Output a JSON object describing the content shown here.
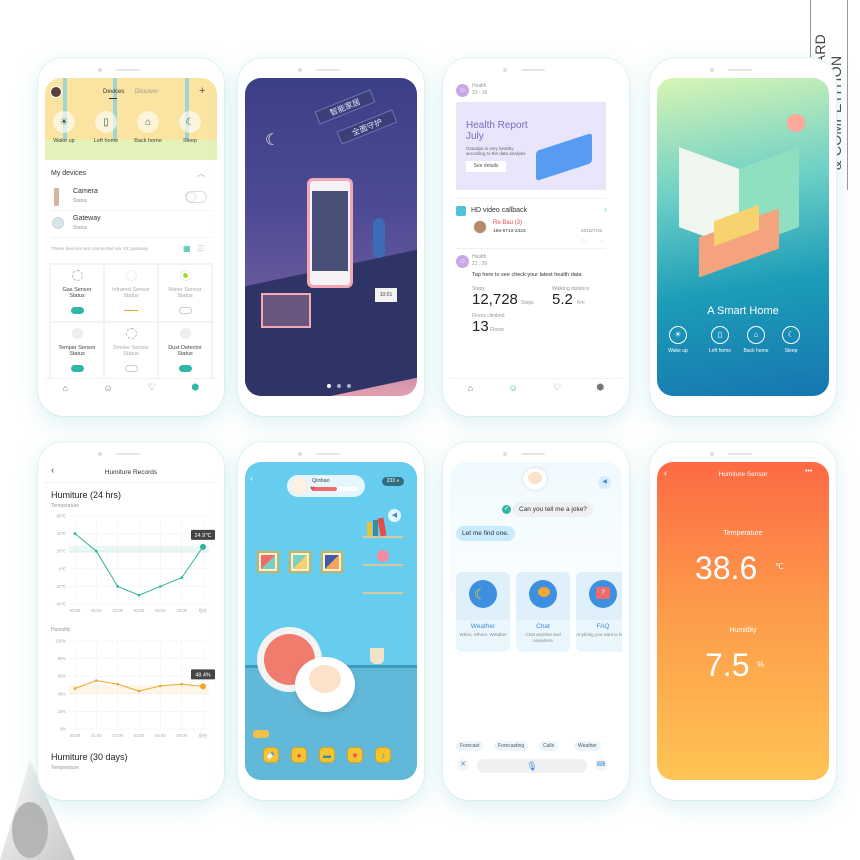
{
  "award": {
    "line1": "A'DESIGN AWARD",
    "line2": "& COMPETITION"
  },
  "phone1": {
    "tabs": [
      "Devices",
      "Discover"
    ],
    "add_icon": "+",
    "scenes": [
      {
        "label": "Wake up",
        "icon": "sunrise-icon"
      },
      {
        "label": "Left home",
        "icon": "door-icon"
      },
      {
        "label": "Back home",
        "icon": "sofa-icon"
      },
      {
        "label": "Sleep",
        "icon": "moon-icon"
      }
    ],
    "section_title": "My devices",
    "devices": [
      {
        "name": "Camera",
        "status": "Status",
        "on": false
      },
      {
        "name": "Gateway",
        "status": "Status"
      }
    ],
    "gateway_note": "These devices are connected via XX gateway",
    "sensors": [
      {
        "name": "Gas Sensor",
        "status": "Status",
        "state": "on",
        "active": true
      },
      {
        "name": "Infrared Sensor",
        "status": "Status",
        "state": "line",
        "active": false
      },
      {
        "name": "Water Sensor",
        "status": "Status",
        "state": "off",
        "active": false
      },
      {
        "name": "Temper Sensor",
        "status": "Status",
        "state": "on",
        "active": true
      },
      {
        "name": "Smoke Sensor",
        "status": "Status",
        "state": "off",
        "active": false
      },
      {
        "name": "Dust Detector",
        "status": "Status",
        "state": "on",
        "active": true
      }
    ],
    "nav": [
      "home-icon",
      "robot-icon",
      "heart-icon",
      "cube-icon"
    ]
  },
  "phone2": {
    "slogan1": "智能家居",
    "slogan2": "全面守护",
    "clock": "10:01",
    "pager_total": 3,
    "pager_active": 1
  },
  "phone3": {
    "health1": {
      "source": "Health",
      "time": "23 : 16"
    },
    "report": {
      "title1": "Health Report",
      "title2": "July",
      "desc1": "Grandpa is very healthy",
      "desc2": "according to the data analysis",
      "button": "See details"
    },
    "video": {
      "title": "HD video callback",
      "caller": "Re Bau",
      "count": "(3)",
      "phone": "186-6710-2323",
      "date": "2015/7/31"
    },
    "health2": {
      "source": "Health",
      "time": "21 : 20",
      "prompt": "Tap here to see check your latest health data"
    },
    "stats": {
      "steps_label": "Steps",
      "steps_value": "12,728",
      "steps_unit": "Steps",
      "walk_label": "Walking distance",
      "walk_value": "5.2",
      "walk_unit": "Km",
      "floors_label": "Floors climbed",
      "floors_value": "13",
      "floors_unit": "Floors"
    }
  },
  "phone4": {
    "title": "A Smart Home",
    "scenes": [
      "Wake up",
      "Left home",
      "Back home",
      "Sleep"
    ]
  },
  "phone5": {
    "header": "Humiture Records",
    "section1": "Humiture (24 hrs)",
    "section2": "Humiture (30 days)",
    "section2_sub": "Temperature"
  },
  "chart_data": [
    {
      "type": "line",
      "title": "Temperature",
      "categories": [
        "00:00",
        "01:00",
        "02:00",
        "03:00",
        "04:00",
        "05:00",
        "现在"
      ],
      "values": [
        40,
        20,
        -20,
        -30,
        -20,
        -10,
        24.9
      ],
      "ylim": [
        -40,
        60
      ],
      "yticks": [
        "60℃",
        "40℃",
        "20℃",
        "0℃",
        "-20℃",
        "-40℃"
      ],
      "highlight_label": "24.9℃",
      "color": "#2db29c"
    },
    {
      "type": "line",
      "title": "Humidity",
      "categories": [
        "00:00",
        "01:00",
        "02:00",
        "03:00",
        "04:00",
        "05:00",
        "现在"
      ],
      "values": [
        46,
        55,
        51,
        43,
        49,
        51,
        48.4
      ],
      "ylim": [
        0,
        100
      ],
      "yticks": [
        "100%",
        "80%",
        "60%",
        "40%",
        "20%",
        "0%"
      ],
      "highlight_label": "48.4%",
      "color": "#f0a52a"
    }
  ],
  "phone6": {
    "pet_name": "Qinbao",
    "coins": "233",
    "toolbar": [
      "bottle-icon",
      "microphone-icon",
      "burger-icon",
      "star-icon",
      "bell-icon"
    ]
  },
  "phone7": {
    "user_msg": "Can you tell me a joke?",
    "bot_msg": "Let me find one.",
    "cards": [
      {
        "name": "Weather",
        "desc": "When, Where, Weather"
      },
      {
        "name": "Chat",
        "desc": "Chat anytime and anywhere"
      },
      {
        "name": "FAQ",
        "desc": "Anything you want to know"
      }
    ],
    "chips": [
      "Forecast",
      "Forecasting",
      "Calls",
      "Weather"
    ]
  },
  "phone8": {
    "header": "Humiture Sensor",
    "temp_label": "Temperature",
    "temp_value": "38.6",
    "temp_unit": "℃",
    "hum_label": "Humidity",
    "hum_value": "7.5",
    "hum_unit": "%"
  }
}
